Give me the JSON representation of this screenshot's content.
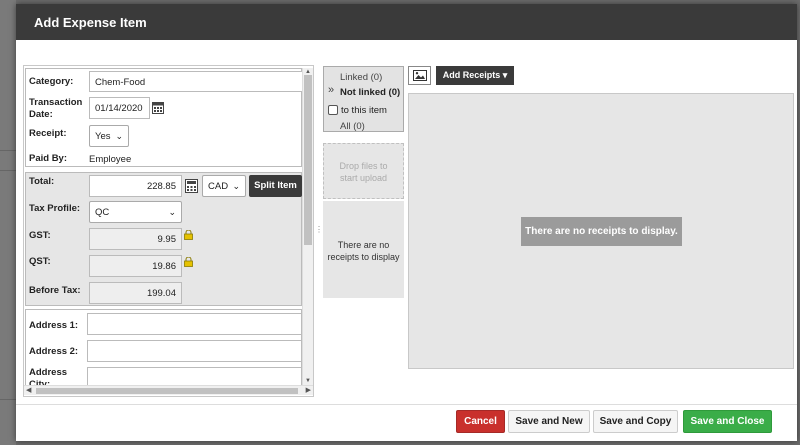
{
  "dialog": {
    "title": "Add Expense Item"
  },
  "details": {
    "category_label": "Category:",
    "category_value": "Chem-Food",
    "transaction_date_label_1": "Transaction",
    "transaction_date_label_2": "Date:",
    "transaction_date_value": "01/14/2020",
    "receipt_label": "Receipt:",
    "receipt_value": "Yes",
    "paid_by_label": "Paid By:",
    "paid_by_value": "Employee"
  },
  "amounts": {
    "total_label": "Total:",
    "total_value": "228.85",
    "currency_value": "CAD",
    "split_item_label": "Split Item",
    "tax_profile_label": "Tax Profile:",
    "tax_profile_value": "QC",
    "gst_label": "GST:",
    "gst_value": "9.95",
    "qst_label": "QST:",
    "qst_value": "19.86",
    "before_tax_label": "Before Tax:",
    "before_tax_value": "199.04"
  },
  "address": {
    "address1_label": "Address 1:",
    "address2_label": "Address 2:",
    "city_label_1": "Address",
    "city_label_2": "City:"
  },
  "link_filter": {
    "linked": "Linked (0)",
    "not_linked": "Not linked (0)",
    "to_this_item": "to this item",
    "all": "All (0)"
  },
  "drop_zone": {
    "text_1": "Drop files to",
    "text_2": "start upload"
  },
  "mid_empty": {
    "text_1": "There are no",
    "text_2": "receipts to display"
  },
  "receipts": {
    "add_button": "Add Receipts",
    "empty_message": "There are no receipts to display."
  },
  "footer": {
    "cancel": "Cancel",
    "save_and_new": "Save and New",
    "save_and_copy": "Save and Copy",
    "save_and_close": "Save and Close"
  },
  "colors": {
    "header": "#3a3a3a",
    "cancel": "#c9302c",
    "save_close": "#3aad48",
    "lock": "#e6c200"
  }
}
